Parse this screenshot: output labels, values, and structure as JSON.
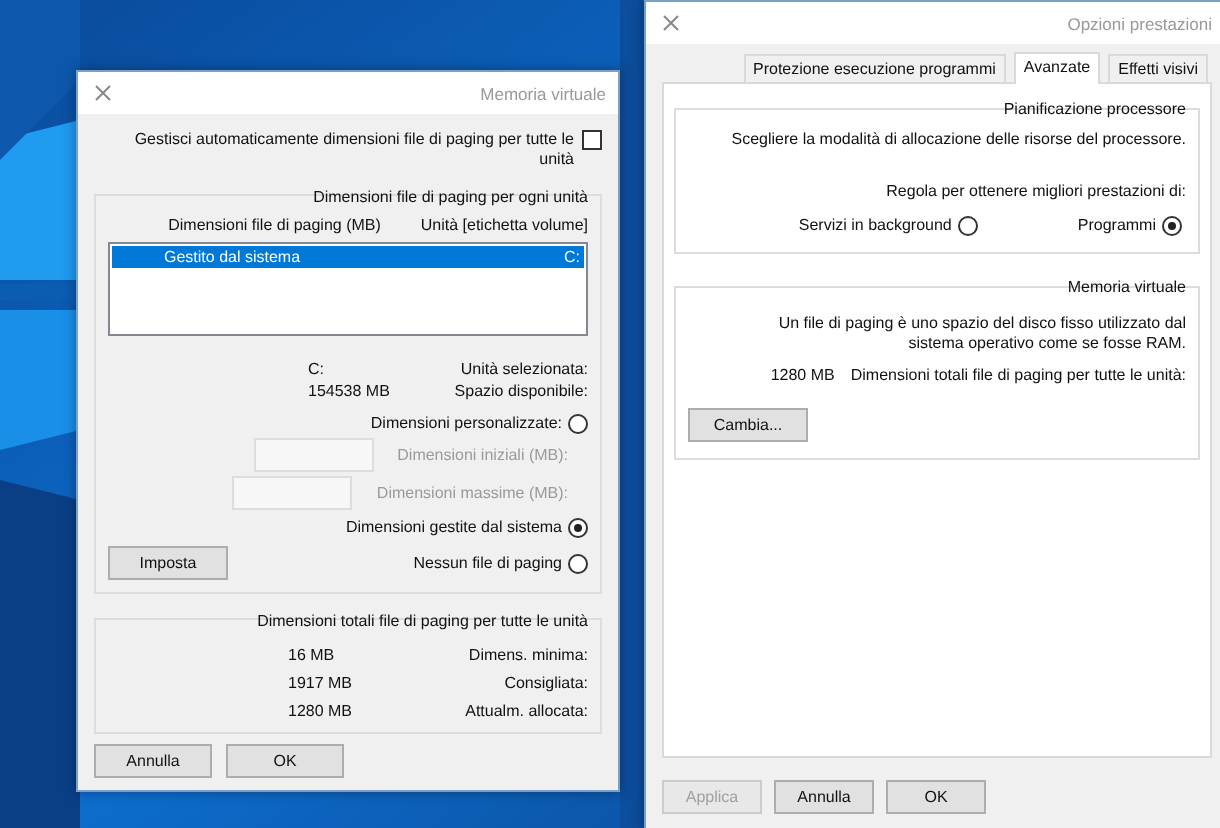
{
  "virtual_memory_dialog": {
    "title": "Memoria virtuale",
    "auto_manage": {
      "label": "Gestisci automaticamente dimensioni file di paging per tutte le unità",
      "checked": false
    },
    "per_drive_group": {
      "title": "Dimensioni file di paging per ogni unità",
      "columns": [
        "Dimensioni file di paging (MB)",
        "Unità [etichetta volume]"
      ],
      "rows": [
        {
          "size": "Gestito dal sistema",
          "drive": "C:",
          "selected": true
        }
      ],
      "selected_drive": {
        "label": "Unità selezionata:",
        "value": "C:"
      },
      "free_space": {
        "label": "Spazio disponibile:",
        "value": "154538 MB"
      },
      "options": [
        {
          "label": "Dimensioni personalizzate:",
          "selected": false,
          "fields": [
            {
              "label": "Dimensioni iniziali (MB):",
              "disabled": true
            },
            {
              "label": "Dimensioni massime (MB):",
              "disabled": true
            }
          ]
        },
        {
          "label": "Dimensioni gestite dal sistema",
          "selected": true
        },
        {
          "label": "Nessun file di paging",
          "selected": false
        }
      ],
      "set_button": "Imposta"
    },
    "totals_group": {
      "title": "Dimensioni totali file di paging per tutte le unità",
      "rows": [
        {
          "label": "Dimens. minima:",
          "value": "16 MB"
        },
        {
          "label": "Consigliata:",
          "value": "1917 MB"
        },
        {
          "label": "Attualm. allocata:",
          "value": "1280 MB"
        }
      ]
    },
    "buttons": [
      {
        "label": "Annulla",
        "disabled": false
      },
      {
        "label": "OK",
        "disabled": false
      }
    ]
  },
  "performance_dialog": {
    "title": "Opzioni prestazioni",
    "tabs": [
      {
        "label": "Protezione esecuzione programmi",
        "selected": false
      },
      {
        "label": "Avanzate",
        "selected": true
      },
      {
        "label": "Effetti visivi",
        "selected": false
      }
    ],
    "processor_group": {
      "title": "Pianificazione processore",
      "description": "Scegliere la modalità di allocazione delle risorse del processore.",
      "prompt": "Regola per ottenere migliori prestazioni di:",
      "options": [
        {
          "label": "Servizi in background",
          "selected": false
        },
        {
          "label": "Programmi",
          "selected": true
        }
      ]
    },
    "virtual_memory_group": {
      "title": "Memoria virtuale",
      "description": "Un file di paging è uno spazio del disco fisso utilizzato dal sistema operativo come se fosse RAM.",
      "total_label": "Dimensioni totali file di paging per tutte le unità:",
      "total_value": "1280 MB",
      "change_button": "Cambia..."
    },
    "buttons": [
      {
        "label": "Applica",
        "disabled": true
      },
      {
        "label": "Annulla",
        "disabled": false
      },
      {
        "label": "OK",
        "disabled": false
      }
    ]
  }
}
